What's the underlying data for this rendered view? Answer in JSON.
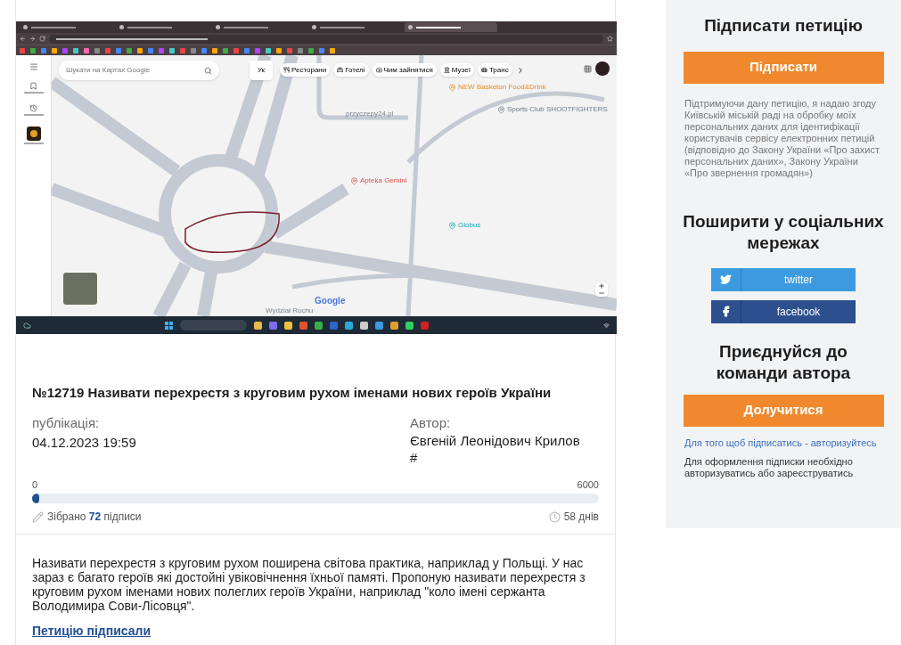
{
  "embedded_screenshot": {
    "browser_tabs": [
      {
        "selected": false
      },
      {
        "selected": false
      },
      {
        "selected": false
      },
      {
        "selected": false
      },
      {
        "selected": true
      }
    ],
    "maps": {
      "search_placeholder": "Шукати на Картах Google",
      "language": "Ук",
      "chips": [
        "Ресторани",
        "Готелі",
        "Чим зайнятися",
        "Музеї",
        "Транс"
      ],
      "sidebar": [
        {
          "kind": "bookmark"
        },
        {
          "kind": "history"
        },
        {
          "kind": "place"
        }
      ],
      "places": [
        {
          "label": "przyczepy24.pl",
          "kind": "plain"
        },
        {
          "label": "NEW Basketon Food&Drink",
          "kind": "food"
        },
        {
          "label": "Sports Club SHOOTFIGHTERS",
          "kind": "pin"
        },
        {
          "label": "Apteka Gemini",
          "kind": "pharmacy"
        },
        {
          "label": "Globus",
          "kind": "shop"
        },
        {
          "label": "Wydział Ruchu",
          "kind": "plain"
        }
      ],
      "logo": "Google"
    }
  },
  "petition": {
    "title": "№12719 Називати перехрестя з круговим рухом іменами нових героїв України",
    "published_label": "публікація:",
    "published": "04.12.2023 19:59",
    "author_label": "Автор:",
    "author": "Євгеній Леонідович Крилов",
    "author_extra": "#",
    "scale_min": "0",
    "scale_max": "6000",
    "level": 0.012,
    "collected_before": "Зібрано",
    "collected_count": "72",
    "collected_after": "підписи",
    "days": "58 днів",
    "text": "Називати перехрестя з круговим рухом поширена світова практика, наприклад у Польщі. У нас зараз є багато героїв які достойні увіковічнення їхньої памяті. Пропоную називати перехрестя з круговим рухом іменами нових полеглих героїв України, наприклад \"коло імені сержанта Володимира Сови-Лісовця\".",
    "signed_link": "Петицію підписали"
  },
  "sidebar": {
    "sign_title": "Підписати петицію",
    "sign_button": "Підписати",
    "consent": "Підтримуючи дану петицію, я надаю згоду Київській міській раді на обробку моїх персональних даних для ідентифікації користувачів сервісу електронних петицій (відповідно до Закону України «Про захист персональних даних», Закону України «Про звернення громадян»)",
    "share_title": "Поширити у соціальних мережах",
    "share": [
      {
        "label": "twitter",
        "kind": "twitter"
      },
      {
        "label": "facebook",
        "kind": "facebook"
      }
    ],
    "join_title": "Приєднуйся до команди автора",
    "join_button": "Долучитися",
    "auth_link": "Для того щоб підписатись - авторизуйтесь",
    "auth_note": "Для оформлення підписки необхідно авторизуватись або зареєструватись"
  }
}
